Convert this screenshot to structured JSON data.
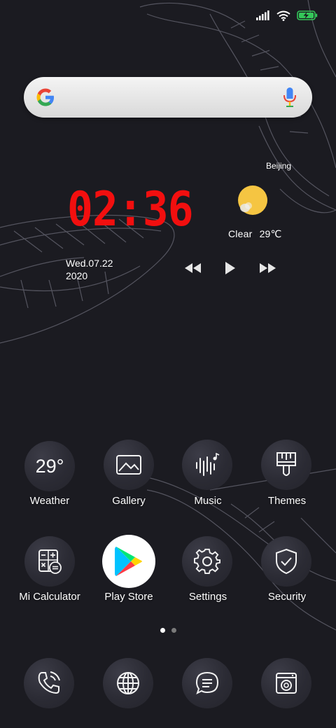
{
  "status_bar": {
    "icons": [
      "signal-icon",
      "wifi-icon",
      "battery-charging-icon"
    ],
    "battery_color": "#34c759"
  },
  "search": {
    "logo": "google-logo",
    "mic_icon": "mic-icon"
  },
  "weather_widget": {
    "city": "Beijing",
    "icon": "sun-icon",
    "condition": "Clear",
    "temperature": "29℃"
  },
  "clock_widget": {
    "time": "02:36",
    "date": "Wed.07.22",
    "year": "2020",
    "time_color": "#f20f0f"
  },
  "music_controls": {
    "icons": [
      "previous-icon",
      "play-icon",
      "next-icon"
    ]
  },
  "apps": {
    "row1": [
      {
        "label": "Weather",
        "icon": "weather-icon",
        "value": "29°"
      },
      {
        "label": "Gallery",
        "icon": "gallery-icon"
      },
      {
        "label": "Music",
        "icon": "music-icon"
      },
      {
        "label": "Themes",
        "icon": "themes-brush-icon"
      }
    ],
    "row2": [
      {
        "label": "Mi Calculator",
        "icon": "calculator-icon"
      },
      {
        "label": "Play Store",
        "icon": "play-store-icon"
      },
      {
        "label": "Settings",
        "icon": "gear-icon"
      },
      {
        "label": "Security",
        "icon": "shield-check-icon"
      }
    ]
  },
  "page_indicator": {
    "count": 2,
    "active": 1,
    "active_color": "#ffffff",
    "inactive_color": "#7a7a7a"
  },
  "dock": {
    "icons": [
      "phone-icon",
      "browser-globe-icon",
      "messages-icon",
      "camera-icon"
    ]
  }
}
